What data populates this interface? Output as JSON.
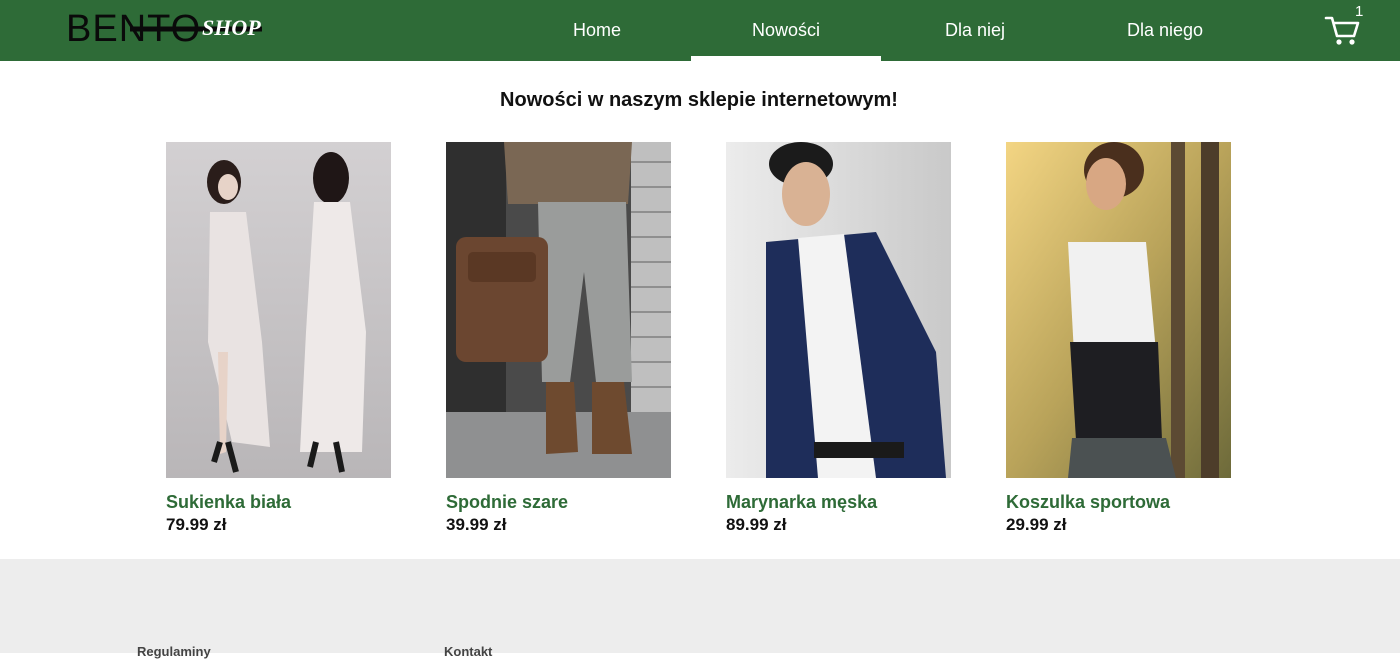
{
  "header": {
    "logo_icon": "bento-shop-logo",
    "nav": [
      {
        "label": "Home",
        "active": false
      },
      {
        "label": "Nowości",
        "active": true
      },
      {
        "label": "Dla niej",
        "active": false
      },
      {
        "label": "Dla niego",
        "active": false
      }
    ],
    "cart_icon": "shopping-cart-icon",
    "cart_count": "1",
    "brand_color": "#2e6b37"
  },
  "main": {
    "title": "Nowości w naszym sklepie internetowym!",
    "products": [
      {
        "name": "Sukienka biała",
        "price": "79.99 zł"
      },
      {
        "name": "Spodnie szare",
        "price": "39.99 zł"
      },
      {
        "name": "Marynarka męska",
        "price": "89.99 zł"
      },
      {
        "name": "Koszulka sportowa",
        "price": "29.99 zł"
      }
    ]
  },
  "footer": {
    "links": [
      "Regulaminy",
      "Kontakt"
    ]
  }
}
